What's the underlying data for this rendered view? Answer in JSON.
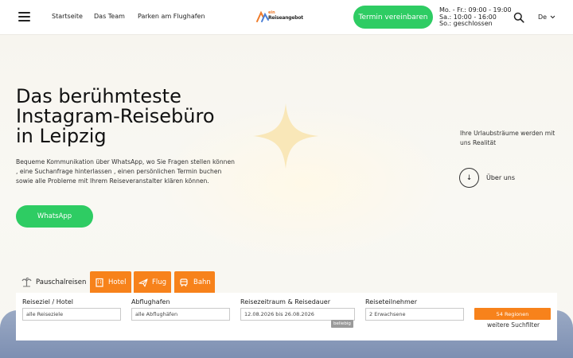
{
  "header": {
    "nav": [
      "Startseite",
      "Das Team",
      "Parken am Flughafen"
    ],
    "logo": {
      "line1": "ein",
      "line2": "Reiseangebot"
    },
    "cta": "Termin vereinbaren",
    "hours": [
      "Mo. - Fr.: 09:00 - 19:00",
      "Sa.: 10:00 - 16:00",
      "So.: geschlossen"
    ],
    "language": "De"
  },
  "hero": {
    "title_lines": [
      "Das berühmteste",
      "Instagram-Reisebüro",
      "in Leipzig"
    ],
    "description": "Bequeme Kommunikation über WhatsApp, wo Sie Fragen stellen können , eine Suchanfrage hinterlassen , einen persönlichen Termin buchen sowie alle Probleme mit Ihrem Reiseveranstalter klären können.",
    "whatsapp_button": "WhatsApp",
    "side_text": "Ihre Urlaubsträume werden mit uns Realität",
    "about_link": "Über uns"
  },
  "search": {
    "tabs": [
      {
        "label": "Pauschalreisen",
        "icon": "palm-tree-icon"
      },
      {
        "label": "Hotel",
        "icon": "hotel-icon"
      },
      {
        "label": "Flug",
        "icon": "plane-icon"
      },
      {
        "label": "Bahn",
        "icon": "train-icon"
      }
    ],
    "fields": {
      "destination": {
        "label": "Reiseziel / Hotel",
        "value": "alle Reiseziele"
      },
      "airport": {
        "label": "Abflughafen",
        "value": "alle Abflughäfen"
      },
      "period": {
        "label": "Reisezeitraum & Reisedauer",
        "value": "12.08.2026 bis 26.08.2026",
        "badge": "beliebig"
      },
      "travelers": {
        "label": "Reiseteilnehmer",
        "value": "2 Erwachsene"
      }
    },
    "submit": "54 Regionen",
    "more_filters": "weitere Suchfilter"
  },
  "colors": {
    "green": "#2ecc63",
    "orange": "#f7821b",
    "sparkle": "#f9e7b8"
  }
}
